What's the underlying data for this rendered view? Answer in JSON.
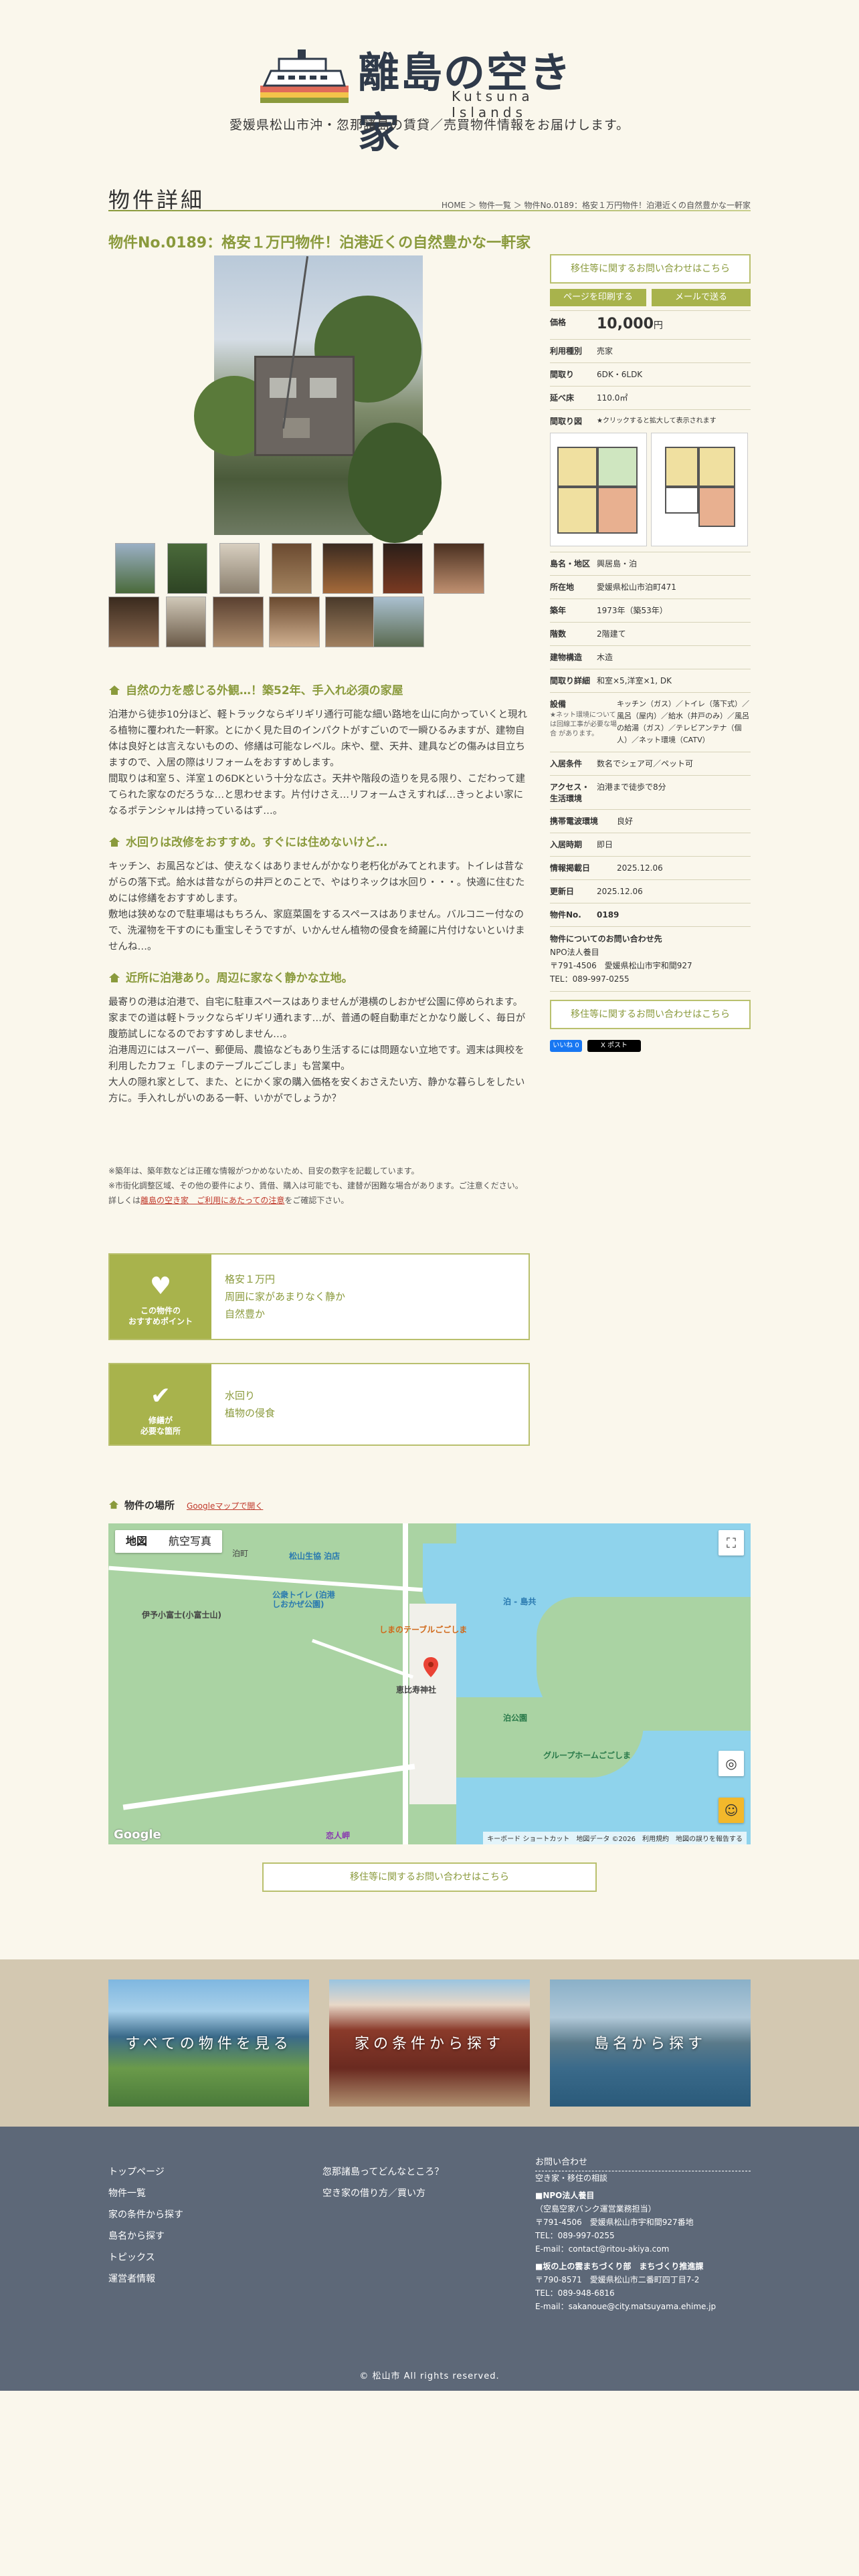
{
  "header": {
    "logo_title": "離島の空き家",
    "logo_sub": "Kutsuna Islands",
    "tagline": "愛媛県松山市沖・忽那諸島の賃貸／売買物件情報をお届けします。"
  },
  "page": {
    "heading": "物件詳細",
    "breadcrumb": "HOME ＞ 物件一覧 ＞ 物件No.0189：格安１万円物件！泊港近くの自然豊かな一軒家",
    "title": "物件No.0189：格安１万円物件！泊港近くの自然豊かな一軒家"
  },
  "sections": [
    {
      "title": "自然の力を感じる外観…！築52年、手入れ必須の家屋",
      "body": "泊港から徒歩10分ほど、軽トラックならギリギリ通行可能な細い路地を山に向かっていくと現れる植物に覆われた一軒家。とにかく見た目のインパクトがすごいので一瞬ひるみますが、建物自体は良好とは言えないものの、修繕は可能なレベル。床や、壁、天井、建具などの傷みは目立ちますので、入居の際はリフォームをおすすめします。\n間取りは和室５、洋室１の6DKという十分な広さ。天井や階段の造りを見る限り、こだわって建てられた家なのだろうな…と思わせます。片付けさえ…リフォームさえすれば…きっとよい家になるポテンシャルは持っているはず…。"
    },
    {
      "title": "水回りは改修をおすすめ。すぐには住めないけど…",
      "body": "キッチン、お風呂などは、使えなくはありませんがかなり老朽化がみてとれます。トイレは昔ながらの落下式。給水は昔ながらの井戸とのことで、やはりネックは水回り・・・。快適に住むためには修繕をおすすめします。\n敷地は狭めなので駐車場はもちろん、家庭菜園をするスペースはありません。バルコニー付なので、洗濯物を干すのにも重宝しそうですが、いかんせん植物の侵食を綺麗に片付けないといけませんね…。"
    },
    {
      "title": "近所に泊港あり。周辺に家なく静かな立地。",
      "body": "最寄りの港は泊港で、自宅に駐車スペースはありませんが港横のしおかぜ公園に停められます。家までの道は軽トラックならギリギリ通れます…が、普通の軽自動車だとかなり厳しく、毎日が腹筋試しになるのでおすすめしません…。\n泊港周辺にはスーパー、郵便局、農協などもあり生活するには問題ない立地です。週末は興校を利用したカフェ「しまのテーブルごごしま」も営業中。\n大人の隠れ家として、また、とにかく家の購入価格を安くおさえたい方、静かな暮らしをしたい方に。手入れしがいのある一軒、いかがでしょうか？"
    }
  ],
  "notes": "※築年は、築年数などは正確な情報がつかめないため、目安の数字を記載しています。\n※市街化調整区域、その他の要件により、賃借、購入は可能でも、建替が困難な場合があります。ご注意ください。詳しくは",
  "notes_link": "離島の空き家　ご利用にあたっての注意",
  "notes_tail": "をご確認下さい。",
  "points": {
    "label1": "この物件の",
    "label2": "おすすめポイント",
    "items": [
      "格安１万円",
      "周囲に家があまりなく静か",
      "自然豊か"
    ]
  },
  "repairs": {
    "label1": "修繕が",
    "label2": "必要な箇所",
    "items": [
      "水回り",
      "植物の侵食"
    ]
  },
  "map": {
    "heading": "物件の場所",
    "gmap_link": "Googleマップで開く",
    "btn_map": "地図",
    "btn_sat": "航空写真",
    "labels": [
      "松山生協 泊店",
      "公衆トイレ (泊港しおかぜ公園)",
      "泊 - 島共",
      "しまのテーブルごごしま",
      "伊予小富士(小富士山)",
      "恵比寿神社",
      "泊公園",
      "グループホームごごしま",
      "恋人岬",
      "泊町"
    ],
    "footer": "キーボード ショートカット　地図データ ©2026　利用規約　地図の誤りを報告する",
    "google": "Google"
  },
  "contact_btn": "移住等に関するお問い合わせはこちら",
  "side": {
    "contact_btn": "移住等に関するお問い合わせはこちら",
    "print_btn": "ページを印刷する",
    "mail_btn": "メールで送る",
    "price_label": "価格",
    "price": "10,000",
    "price_unit": "円",
    "rows": [
      {
        "k": "利用種別",
        "v": "売家"
      },
      {
        "k": "間取り",
        "v": "6DK・6LDK"
      },
      {
        "k": "延べ床",
        "v": "110.0㎡"
      }
    ],
    "fp_label": "間取り図",
    "fp_note": "★クリックすると拡大して表示されます",
    "rows2": [
      {
        "k": "島名・地区",
        "v": "興居島・泊"
      },
      {
        "k": "所在地",
        "v": "愛媛県松山市泊町471"
      },
      {
        "k": "築年",
        "v": "1973年（築53年）"
      },
      {
        "k": "階数",
        "v": "2階建て"
      },
      {
        "k": "建物構造",
        "v": "木造"
      },
      {
        "k": "間取り詳細",
        "v": "和室×5,洋室×1, DK"
      }
    ],
    "equip_k": "設備",
    "equip_note": "★ネット環境について は回線工事が必要な場合 があります。",
    "equip_v": "キッチン（ガス）／トイレ（落下式）／風呂（屋内）／給水（井戸のみ）／風呂の給湯（ガス）／テレビアンテナ（個人）／ネット環境（CATV）",
    "rows3": [
      {
        "k": "入居条件",
        "v": "数名でシェア可／ペット可"
      },
      {
        "k": "アクセス・生活環境",
        "v": "泊港まで徒歩で8分"
      },
      {
        "k": "携帯電波環境",
        "v": "良好"
      },
      {
        "k": "入居時期",
        "v": "即日"
      },
      {
        "k": "情報掲載日",
        "v": "2025.12.06"
      },
      {
        "k": "更新日",
        "v": "2025.12.06"
      },
      {
        "k": "物件No.",
        "v": "0189"
      }
    ],
    "contact_title": "物件についてのお問い合わせ先",
    "contact_body": "NPO法人養目\n〒791-4506　愛媛県松山市宇和間927\nTEL：089-997-0255",
    "share_fb": "いいね 0",
    "share_x": "X ポスト"
  },
  "banners": [
    "すべての物件を見る",
    "家の条件から探す",
    "島名から探す"
  ],
  "footer": {
    "col1": [
      "トップページ",
      "物件一覧",
      "家の条件から探す",
      "島名から探す",
      "トピックス",
      "運営者情報"
    ],
    "col2": [
      "忽那諸島ってどんなところ？",
      "空き家の借り方／買い方"
    ],
    "c_head": "お問い合わせ",
    "c_sub": "空き家・移住の相談",
    "npo_name": "■NPO法人養目",
    "npo_sub": "（空島空家バンク運営業務担当）",
    "npo_addr": "〒791-4506　愛媛県松山市宇和間927番地\nTEL：089-997-0255\nE-mail：contact@ritou-akiya.com",
    "city_name": "■坂の上の雲まちづくり部　まちづくり推進課",
    "city_addr": "〒790-8571　愛媛県松山市二番町四丁目7-2\nTEL：089-948-6816\nE-mail：sakanoue@city.matsuyama.ehime.jp",
    "copyright": "© 松山市 All rights reserved."
  }
}
